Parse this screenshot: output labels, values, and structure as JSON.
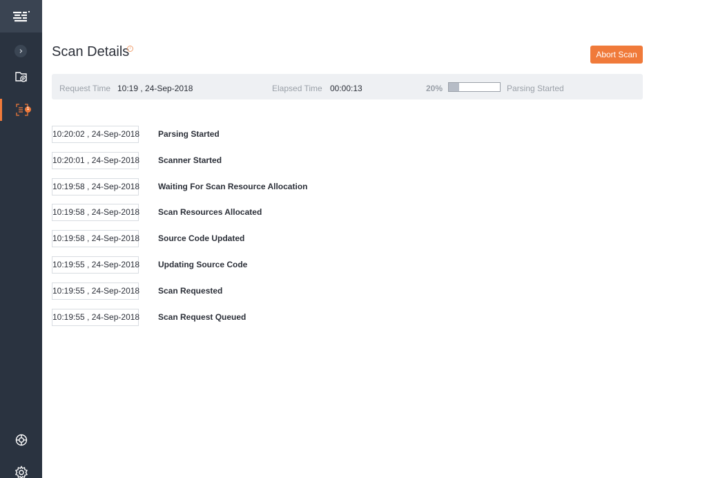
{
  "sidebar": {
    "logo_icon": "app-logo-icon",
    "toggle_icon": "chevron-right-icon",
    "items": [
      {
        "icon": "projects-icon",
        "active": false
      },
      {
        "icon": "scan-icon",
        "active": true,
        "badge": "1"
      }
    ],
    "bottom_items": [
      {
        "icon": "help-lifebuoy-icon"
      },
      {
        "icon": "gear-icon"
      }
    ]
  },
  "header": {
    "title": "Scan Details",
    "info_icon": "info-icon",
    "info_glyph": "i",
    "abort_label": "Abort Scan"
  },
  "info_bar": {
    "request_time_label": "Request Time",
    "request_time_value": "10:19 , 24-Sep-2018",
    "elapsed_time_label": "Elapsed Time",
    "elapsed_time_value": "00:00:13",
    "progress_percent_text": "20%",
    "progress_fraction": 0.2,
    "status": "Parsing Started"
  },
  "events": [
    {
      "time": "10:20:02 , 24-Sep-2018",
      "label": "Parsing Started"
    },
    {
      "time": "10:20:01 , 24-Sep-2018",
      "label": "Scanner Started"
    },
    {
      "time": "10:19:58 , 24-Sep-2018",
      "label": "Waiting For Scan Resource Allocation"
    },
    {
      "time": "10:19:58 , 24-Sep-2018",
      "label": "Scan Resources Allocated"
    },
    {
      "time": "10:19:58 , 24-Sep-2018",
      "label": "Source Code Updated"
    },
    {
      "time": "10:19:55 , 24-Sep-2018",
      "label": "Updating Source Code"
    },
    {
      "time": "10:19:55 , 24-Sep-2018",
      "label": "Scan Requested"
    },
    {
      "time": "10:19:55 , 24-Sep-2018",
      "label": "Scan Request Queued"
    }
  ],
  "colors": {
    "accent": "#f07a3a",
    "sidebar_bg": "#2a3340",
    "info_bar_bg": "#eef0f3"
  }
}
